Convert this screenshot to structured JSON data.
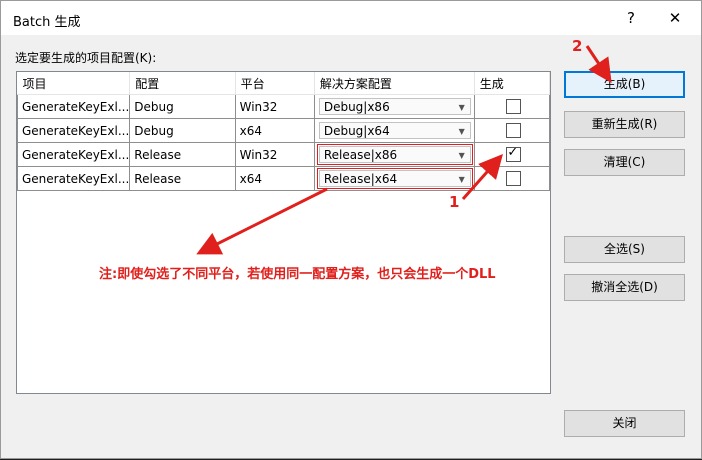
{
  "window": {
    "title": "Batch 生成",
    "help_glyph": "?",
    "close_glyph": "✕"
  },
  "label": "选定要生成的项目配置(K):",
  "grid": {
    "headers": [
      "项目",
      "配置",
      "平台",
      "解决方案配置",
      "生成"
    ],
    "rows": [
      {
        "project": "GenerateKeyExl...",
        "config": "Debug",
        "platform": "Win32",
        "solution": "Debug|x86",
        "checked": false
      },
      {
        "project": "GenerateKeyExl...",
        "config": "Debug",
        "platform": "x64",
        "solution": "Debug|x64",
        "checked": false
      },
      {
        "project": "GenerateKeyExl...",
        "config": "Release",
        "platform": "Win32",
        "solution": "Release|x86",
        "checked": true
      },
      {
        "project": "GenerateKeyExl...",
        "config": "Release",
        "platform": "x64",
        "solution": "Release|x64",
        "checked": false
      }
    ]
  },
  "buttons": {
    "build": "生成(B)",
    "rebuild": "重新生成(R)",
    "clean": "清理(C)",
    "select_all": "全选(S)",
    "deselect_all": "撤消全选(D)",
    "close": "关闭"
  },
  "annotation": {
    "note": "注:即使勾选了不同平台，若使用同一配置方案，也只会生成一个DLL",
    "marker1": "1",
    "marker2": "2",
    "color": "#e0201c"
  },
  "icons": {
    "dropdown": "chevron-down-icon",
    "checkmark": "checkmark-icon"
  }
}
